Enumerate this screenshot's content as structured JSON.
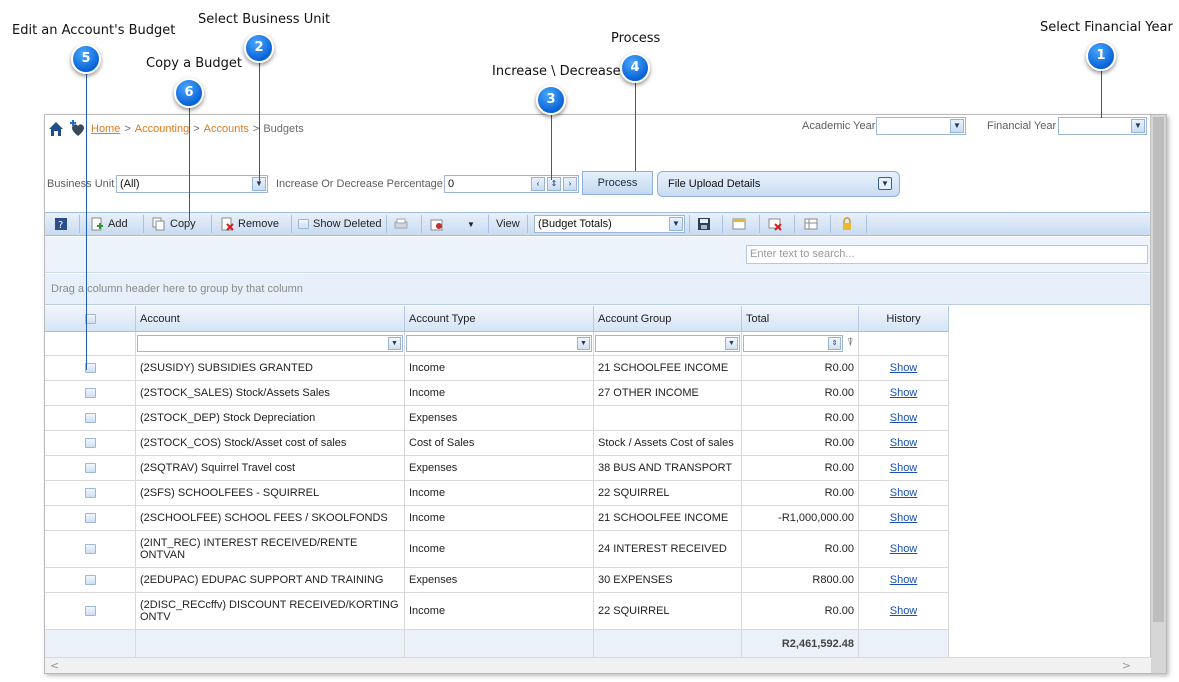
{
  "callouts": {
    "c1": {
      "number": "1",
      "label": "Select Financial Year"
    },
    "c2": {
      "number": "2",
      "label": "Select Business Unit"
    },
    "c3": {
      "number": "3",
      "label": "Increase \\ Decrease"
    },
    "c4": {
      "number": "4",
      "label": "Process"
    },
    "c5": {
      "number": "5",
      "label": "Edit an Account's Budget"
    },
    "c6": {
      "number": "6",
      "label": "Copy a Budget"
    }
  },
  "breadcrumb": {
    "home": "Home",
    "sep": ">",
    "accounting": "Accounting",
    "accounts": "Accounts",
    "current": "Budgets"
  },
  "filters": {
    "academic_year_label": "Academic Year",
    "academic_year_value": "",
    "financial_year_label": "Financial Year",
    "financial_year_value": "",
    "business_unit_label": "Business Unit",
    "business_unit_value": "(All)",
    "percentage_label": "Increase Or Decrease Percentage",
    "percentage_value": "0",
    "process_label": "Process",
    "upload_label": "File Upload Details"
  },
  "toolbar": {
    "add": "Add",
    "copy": "Copy",
    "remove": "Remove",
    "show_deleted": "Show Deleted",
    "view_label": "View",
    "view_value": "(Budget Totals)"
  },
  "search": {
    "placeholder": "Enter text to search..."
  },
  "group_hint": "Drag a column header here to group by that column",
  "grid": {
    "headers": {
      "account": "Account",
      "type": "Account Type",
      "group": "Account Group",
      "total": "Total",
      "history": "History"
    },
    "rows": [
      {
        "account": "(2SUSIDY) SUBSIDIES GRANTED",
        "type": "Income",
        "group": "21 SCHOOLFEE INCOME",
        "total": "R0.00",
        "history": "Show"
      },
      {
        "account": "(2STOCK_SALES) Stock/Assets Sales",
        "type": "Income",
        "group": "27 OTHER INCOME",
        "total": "R0.00",
        "history": "Show"
      },
      {
        "account": "(2STOCK_DEP) Stock Depreciation",
        "type": "Expenses",
        "group": "",
        "total": "R0.00",
        "history": "Show"
      },
      {
        "account": "(2STOCK_COS) Stock/Asset cost of sales",
        "type": "Cost of Sales",
        "group": "Stock / Assets Cost of sales",
        "total": "R0.00",
        "history": "Show"
      },
      {
        "account": "(2SQTRAV) Squirrel Travel cost",
        "type": "Expenses",
        "group": "38 BUS AND TRANSPORT",
        "total": "R0.00",
        "history": "Show"
      },
      {
        "account": "(2SFS) SCHOOLFEES - SQUIRREL",
        "type": "Income",
        "group": "22 SQUIRREL",
        "total": "R0.00",
        "history": "Show"
      },
      {
        "account": "(2SCHOOLFEE) SCHOOL FEES / SKOOLFONDS",
        "type": "Income",
        "group": "21 SCHOOLFEE INCOME",
        "total": "-R1,000,000.00",
        "history": "Show"
      },
      {
        "account": "(2INT_REC) INTEREST RECEIVED/RENTE ONTVAN",
        "type": "Income",
        "group": "24 INTEREST RECEIVED",
        "total": "R0.00",
        "history": "Show"
      },
      {
        "account": "(2EDUPAC) EDUPAC SUPPORT AND TRAINING",
        "type": "Expenses",
        "group": "30 EXPENSES",
        "total": "R800.00",
        "history": "Show"
      },
      {
        "account": "(2DISC_RECcffv) DISCOUNT RECEIVED/KORTING ONTV",
        "type": "Income",
        "group": "22 SQUIRREL",
        "total": "R0.00",
        "history": "Show"
      }
    ],
    "grand_total": "R2,461,592.48"
  }
}
